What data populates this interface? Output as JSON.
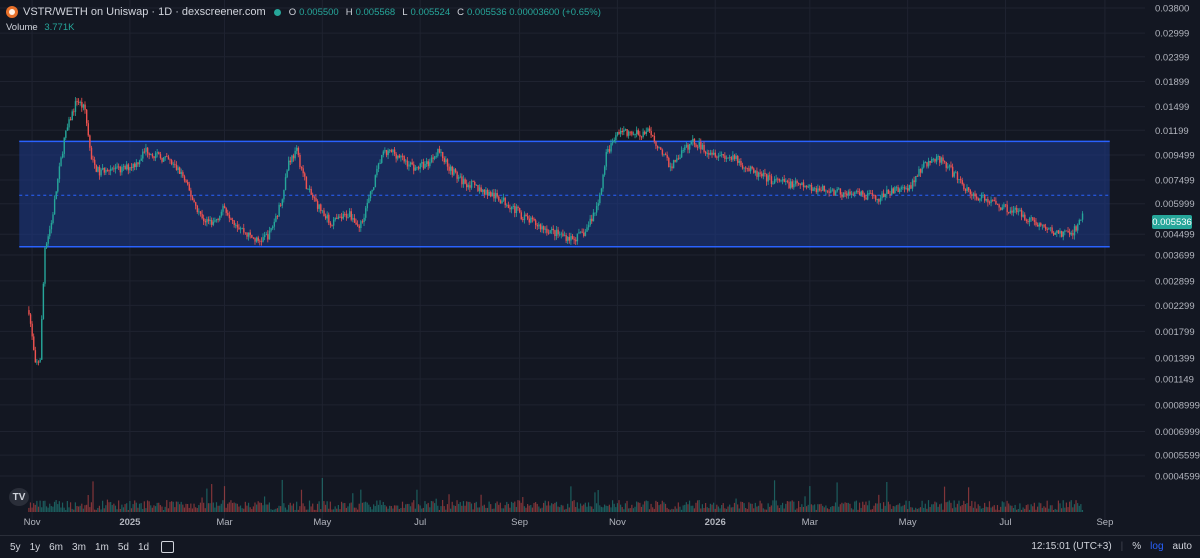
{
  "header": {
    "title": "VSTR/WETH on Uniswap · 1D · dexscreener.com",
    "ohlc": [
      {
        "k": "O",
        "v": "0.005500"
      },
      {
        "k": "H",
        "v": "0.005568"
      },
      {
        "k": "L",
        "v": "0.005524"
      },
      {
        "k": "C",
        "v": "0.005536 0.00003600 (+0.65%)"
      }
    ],
    "volume_label": "Volume",
    "volume_value": "3.771K"
  },
  "colors": {
    "up": "#26a69a",
    "down": "#ef5350",
    "channel_fill": "#1e3a8a",
    "channel_line": "#2962ff"
  },
  "chart_data": {
    "type": "candlestick",
    "title": "VSTR/WETH on Uniswap · 1D · dexscreener.com",
    "y_scale": "log",
    "ylim": [
      0.00036,
      0.038
    ],
    "y_ticks": [
      "0.03800",
      "0.02999",
      "0.02399",
      "0.01899",
      "0.01499",
      "0.01199",
      "0.009499",
      "0.007499",
      "0.005999",
      "0.004499",
      "0.003699",
      "0.002899",
      "0.002299",
      "0.001799",
      "0.001399",
      "0.001149",
      "0.0008999",
      "0.0006999",
      "0.0005599",
      "0.0004599"
    ],
    "x_ticks": [
      "Nov",
      "2025",
      "Mar",
      "May",
      "Jul",
      "Sep",
      "Nov",
      "2026",
      "Mar",
      "May",
      "Jul",
      "Sep"
    ],
    "x_tick_dates": [
      "2024-11-01",
      "2025-01-01",
      "2025-03-01",
      "2025-05-01",
      "2025-07-01",
      "2025-09-01",
      "2025-11-01",
      "2026-01-01",
      "2026-03-01",
      "2026-05-01",
      "2026-07-01",
      "2026-09-01"
    ],
    "x_range": [
      "2024-10-12",
      "2026-09-26"
    ],
    "last_price": "0.005536",
    "channel": {
      "upper": 0.0108,
      "lower": 0.004,
      "mid": 0.0065
    },
    "price_path": [
      [
        "2024-10-30",
        0.0022
      ],
      [
        "2024-11-03",
        0.0013
      ],
      [
        "2024-11-06",
        0.0014
      ],
      [
        "2024-11-09",
        0.004
      ],
      [
        "2024-11-13",
        0.005
      ],
      [
        "2024-11-17",
        0.0075
      ],
      [
        "2024-11-21",
        0.011
      ],
      [
        "2024-11-25",
        0.0135
      ],
      [
        "2024-11-29",
        0.016
      ],
      [
        "2024-12-04",
        0.0145
      ],
      [
        "2024-12-08",
        0.009
      ],
      [
        "2024-12-13",
        0.008
      ],
      [
        "2024-12-18",
        0.0085
      ],
      [
        "2024-12-23",
        0.0082
      ],
      [
        "2024-12-28",
        0.0083
      ],
      [
        "2025-01-05",
        0.0088
      ],
      [
        "2025-01-11",
        0.01
      ],
      [
        "2025-01-18",
        0.0094
      ],
      [
        "2025-01-25",
        0.009
      ],
      [
        "2025-02-02",
        0.008
      ],
      [
        "2025-02-08",
        0.0065
      ],
      [
        "2025-02-15",
        0.0052
      ],
      [
        "2025-02-22",
        0.005
      ],
      [
        "2025-03-01",
        0.0058
      ],
      [
        "2025-03-08",
        0.005
      ],
      [
        "2025-03-15",
        0.0045
      ],
      [
        "2025-03-22",
        0.0042
      ],
      [
        "2025-03-29",
        0.0045
      ],
      [
        "2025-04-05",
        0.006
      ],
      [
        "2025-04-10",
        0.009
      ],
      [
        "2025-04-15",
        0.0098
      ],
      [
        "2025-04-22",
        0.0068
      ],
      [
        "2025-04-29",
        0.0058
      ],
      [
        "2025-05-06",
        0.005
      ],
      [
        "2025-05-12",
        0.0052
      ],
      [
        "2025-05-18",
        0.0055
      ],
      [
        "2025-05-24",
        0.0048
      ],
      [
        "2025-05-31",
        0.0065
      ],
      [
        "2025-06-07",
        0.0095
      ],
      [
        "2025-06-14",
        0.0098
      ],
      [
        "2025-06-21",
        0.009
      ],
      [
        "2025-06-28",
        0.0084
      ],
      [
        "2025-07-06",
        0.0088
      ],
      [
        "2025-07-12",
        0.01
      ],
      [
        "2025-07-19",
        0.0085
      ],
      [
        "2025-07-26",
        0.0075
      ],
      [
        "2025-08-05",
        0.007
      ],
      [
        "2025-08-15",
        0.0065
      ],
      [
        "2025-08-25",
        0.006
      ],
      [
        "2025-09-05",
        0.0052
      ],
      [
        "2025-09-15",
        0.0048
      ],
      [
        "2025-09-25",
        0.0045
      ],
      [
        "2025-10-05",
        0.0043
      ],
      [
        "2025-10-12",
        0.0046
      ],
      [
        "2025-10-20",
        0.006
      ],
      [
        "2025-10-25",
        0.0095
      ],
      [
        "2025-11-02",
        0.012
      ],
      [
        "2025-11-10",
        0.0115
      ],
      [
        "2025-11-20",
        0.0118
      ],
      [
        "2025-11-28",
        0.01
      ],
      [
        "2025-12-04",
        0.0085
      ],
      [
        "2025-12-10",
        0.0095
      ],
      [
        "2025-12-18",
        0.0108
      ],
      [
        "2025-12-26",
        0.01
      ],
      [
        "2026-01-05",
        0.0095
      ],
      [
        "2026-01-15",
        0.009
      ],
      [
        "2026-01-25",
        0.008
      ],
      [
        "2026-02-05",
        0.0075
      ],
      [
        "2026-02-18",
        0.0072
      ],
      [
        "2026-03-01",
        0.007
      ],
      [
        "2026-03-12",
        0.0068
      ],
      [
        "2026-03-22",
        0.0066
      ],
      [
        "2026-04-02",
        0.0065
      ],
      [
        "2026-04-12",
        0.0063
      ],
      [
        "2026-04-22",
        0.0068
      ],
      [
        "2026-05-02",
        0.007
      ],
      [
        "2026-05-10",
        0.0085
      ],
      [
        "2026-05-18",
        0.0092
      ],
      [
        "2026-05-24",
        0.0088
      ],
      [
        "2026-06-02",
        0.0075
      ],
      [
        "2026-06-10",
        0.0065
      ],
      [
        "2026-06-20",
        0.0062
      ],
      [
        "2026-06-30",
        0.0058
      ],
      [
        "2026-07-10",
        0.0055
      ],
      [
        "2026-07-20",
        0.005
      ],
      [
        "2026-07-30",
        0.0046
      ],
      [
        "2026-08-08",
        0.0045
      ],
      [
        "2026-08-14",
        0.0047
      ],
      [
        "2026-08-18",
        0.00553
      ]
    ]
  },
  "bottom": {
    "ranges": [
      "5y",
      "1y",
      "6m",
      "3m",
      "1m",
      "5d",
      "1d"
    ],
    "time": "12:15:01 (UTC+3)",
    "percent": "%",
    "log": "log",
    "auto": "auto"
  }
}
